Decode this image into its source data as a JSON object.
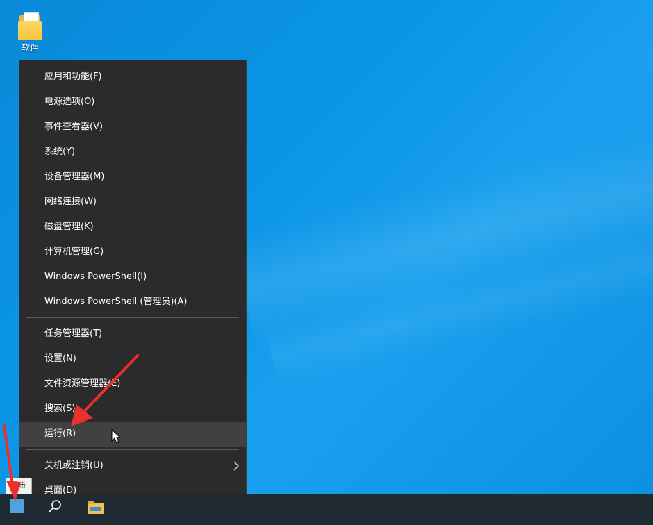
{
  "desktop": {
    "icons": [
      {
        "label": "软件",
        "icon": "folder-icon"
      }
    ]
  },
  "context_menu": {
    "items": [
      {
        "label": "应用和功能(F)"
      },
      {
        "label": "电源选项(O)"
      },
      {
        "label": "事件查看器(V)"
      },
      {
        "label": "系统(Y)"
      },
      {
        "label": "设备管理器(M)"
      },
      {
        "label": "网络连接(W)"
      },
      {
        "label": "磁盘管理(K)"
      },
      {
        "label": "计算机管理(G)"
      },
      {
        "label": "Windows PowerShell(I)"
      },
      {
        "label": "Windows PowerShell (管理员)(A)"
      },
      {
        "label": "任务管理器(T)"
      },
      {
        "label": "设置(N)"
      },
      {
        "label": "文件资源管理器(E)"
      },
      {
        "label": "搜索(S)"
      },
      {
        "label": "运行(R)",
        "highlighted": true
      },
      {
        "label": "关机或注销(U)",
        "has_submenu": true
      },
      {
        "label": "桌面(D)"
      }
    ]
  },
  "taskbar": {
    "start_icon": "windows-logo-icon",
    "search_icon": "search-icon",
    "app_icon": "file-explorer-icon",
    "tooltip": "右击"
  },
  "annotations": {
    "arrow_color": "#e8302c"
  },
  "colors": {
    "desktop_bg": "#0a94e6",
    "menu_bg": "#2b2b2b",
    "menu_hover": "#414141",
    "taskbar_bg": "#1f2a33"
  }
}
